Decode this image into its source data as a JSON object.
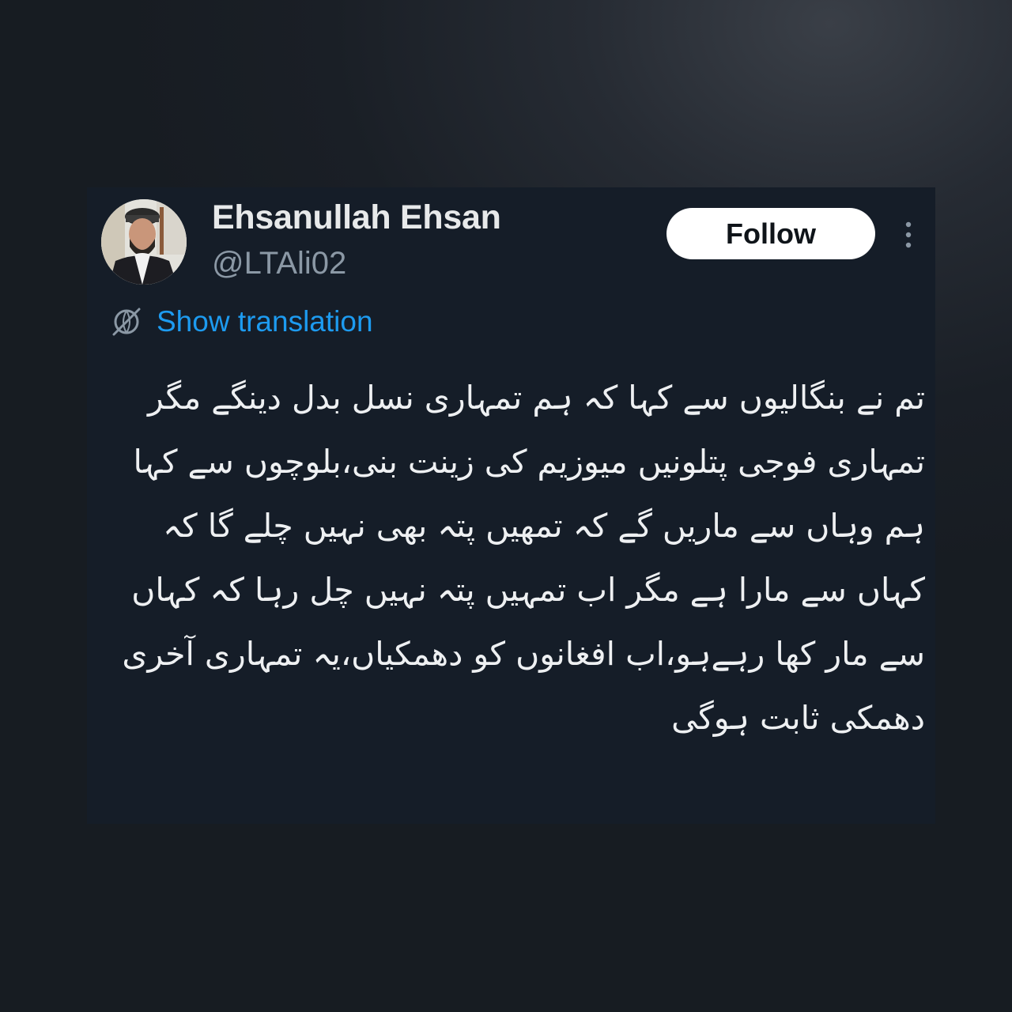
{
  "tweet": {
    "author": {
      "display_name": "Ehsanullah Ehsan",
      "handle": "@LTAli02"
    },
    "follow_label": "Follow",
    "translation_label": "Show translation",
    "text": "تم نے بنگالیوں سے کہا کہ ہم تمہاری نسل بدل دینگے مگر تمہاری فوجی پتلونیں میوزیم کی زینت بنی،بلوچوں سے کہا ہم وہاں سے ماریں گے کہ تمھیں پتہ بھی نہیں چلے گا کہ کہاں سے مارا ہے مگر اب تمہیں پتہ نہیں چل رہا کہ کہاں سے مار کھا رہےہو،اب افغانوں کو دھمکیاں،یہ تمہاری آخری دھمکی ثابت ہوگی"
  },
  "colors": {
    "background": "#1a1f26",
    "card": "#151d28",
    "text_primary": "#e7e9ea",
    "text_secondary": "#8b98a5",
    "link": "#1d9bf0",
    "follow_bg": "#ffffff"
  },
  "icons": {
    "more": "more-vertical-icon",
    "translate": "globe-icon"
  }
}
